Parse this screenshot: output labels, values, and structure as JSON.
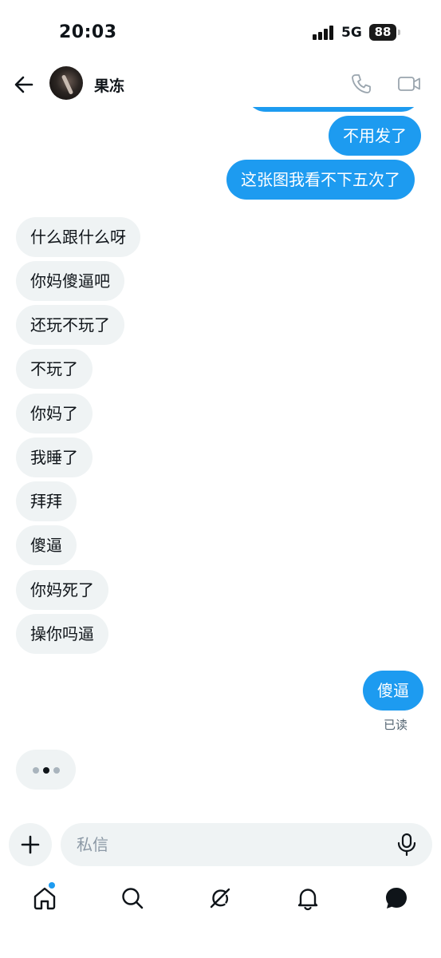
{
  "status_bar": {
    "time": "20:03",
    "network": "5G",
    "battery": "88"
  },
  "header": {
    "contact_name": "果冻"
  },
  "messages": [
    {
      "text": "不用发了",
      "direction": "out"
    },
    {
      "text": "这张图我看不下五次了",
      "direction": "out"
    },
    {
      "text": "什么跟什么呀",
      "direction": "in"
    },
    {
      "text": "你妈傻逼吧",
      "direction": "in"
    },
    {
      "text": "还玩不玩了",
      "direction": "in"
    },
    {
      "text": "不玩了",
      "direction": "in"
    },
    {
      "text": "你妈了",
      "direction": "in"
    },
    {
      "text": "我睡了",
      "direction": "in"
    },
    {
      "text": "拜拜",
      "direction": "in"
    },
    {
      "text": "傻逼",
      "direction": "in"
    },
    {
      "text": "你妈死了",
      "direction": "in"
    },
    {
      "text": "操你吗逼",
      "direction": "in"
    },
    {
      "text": "傻逼",
      "direction": "out"
    }
  ],
  "read_receipt": "已读",
  "composer": {
    "placeholder": "私信"
  },
  "nav": {
    "items": [
      "home-icon",
      "search-icon",
      "grok-icon",
      "notifications-icon",
      "messages-icon"
    ],
    "home_has_dot": true
  },
  "colors": {
    "outgoing_bubble": "#1d9bf0",
    "incoming_bubble": "#eff3f4",
    "accent": "#1d9bf0"
  }
}
